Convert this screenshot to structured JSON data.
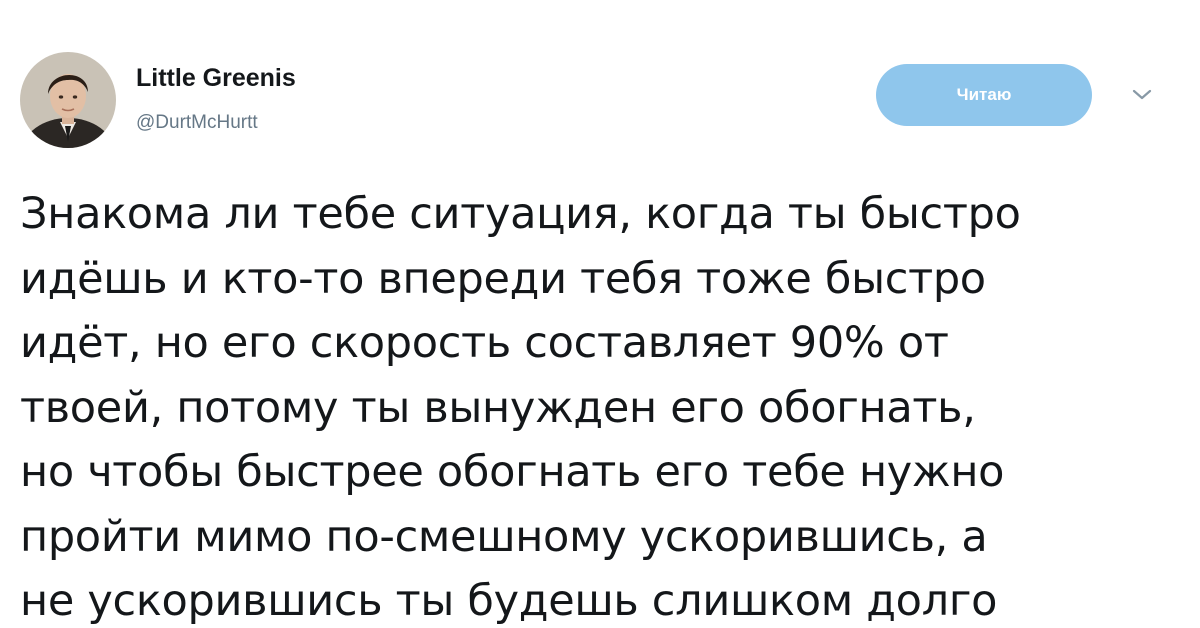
{
  "author": {
    "display_name": "Little Greenis",
    "handle": "@DurtMcHurtt"
  },
  "follow_button": {
    "label": "Читаю",
    "color": "#8fc6ec"
  },
  "menu": {
    "icon": "chevron-down-icon"
  },
  "tweet": {
    "lines": [
      "Знакома ли тебе ситуация, когда ты быстро",
      "идёшь и кто-то впереди тебя тоже быстро",
      "идёт, но его скорость составляет 90% от",
      "твоей, потому ты вынужден его обогнать,",
      "но чтобы быстрее обогнать его тебе нужно",
      "пройти мимо по-смешному ускорившись, а",
      "не ускорившись ты будешь слишком долго"
    ]
  }
}
